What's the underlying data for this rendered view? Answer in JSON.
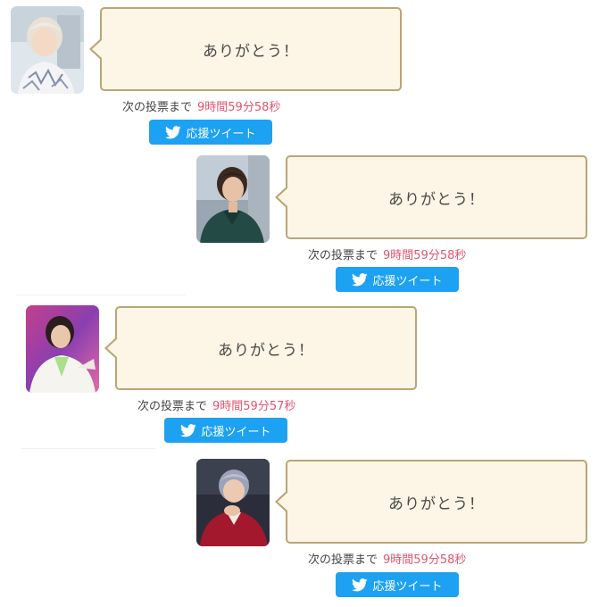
{
  "entries": [
    {
      "message": "ありがとう！",
      "countdown_label": "次の投票まで",
      "countdown_time": "9時間59分58秒",
      "tweet_label": "応援ツイート",
      "avatar_icon": "person-photo-icon"
    },
    {
      "message": "ありがとう！",
      "countdown_label": "次の投票まで",
      "countdown_time": "9時間59分58秒",
      "tweet_label": "応援ツイート",
      "avatar_icon": "person-photo-icon"
    },
    {
      "message": "ありがとう！",
      "countdown_label": "次の投票まで",
      "countdown_time": "9時間59分57秒",
      "tweet_label": "応援ツイート",
      "avatar_icon": "person-photo-icon"
    },
    {
      "message": "ありがとう！",
      "countdown_label": "次の投票まで",
      "countdown_time": "9時間59分58秒",
      "tweet_label": "応援ツイート",
      "avatar_icon": "person-photo-icon"
    }
  ],
  "colors": {
    "bubble_bg": "#fdf5e6",
    "bubble_border": "#b9a676",
    "countdown_time": "#e0556d",
    "tweet_button": "#1da1f2"
  }
}
